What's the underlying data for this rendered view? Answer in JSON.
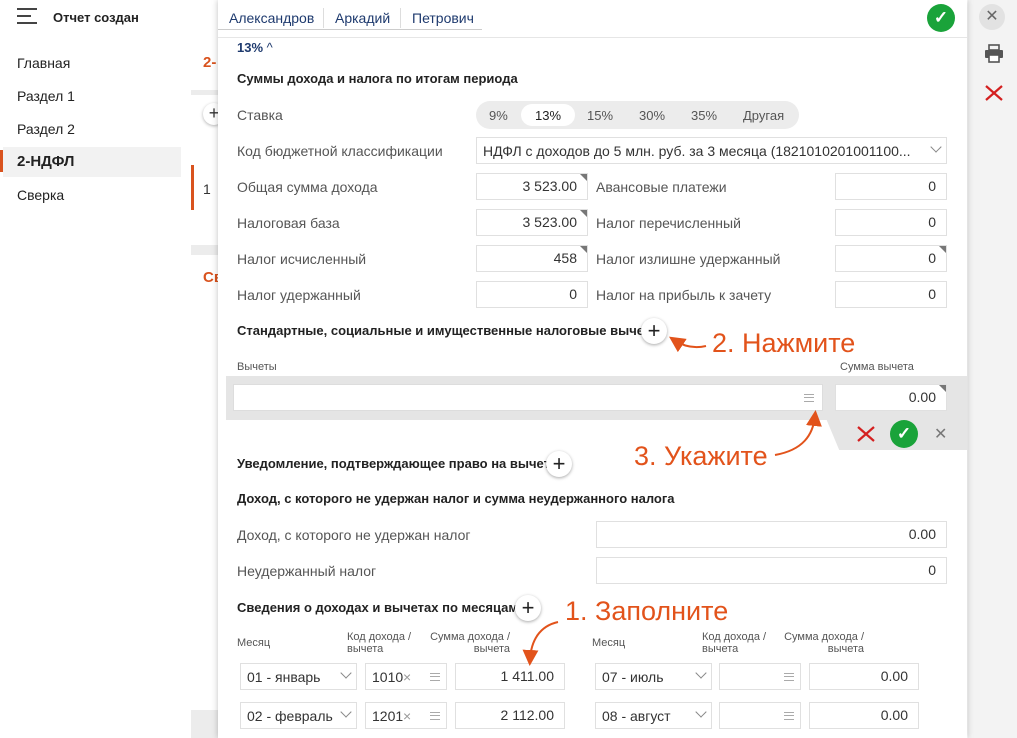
{
  "header": {
    "menu_title": "Отчет создан",
    "name_parts": [
      "Александров",
      "Аркадий",
      "Петрович"
    ],
    "rate_dropdown": "13%"
  },
  "sidebar": {
    "items": [
      "Главная",
      "Раздел 1",
      "Раздел 2",
      "2-НДФЛ",
      "Сверка"
    ]
  },
  "background": {
    "frag1": "2-",
    "frag2": "1",
    "frag3": "Св"
  },
  "section_totals": {
    "title": "Суммы дохода и налога по итогам периода",
    "rate_label": "Ставка",
    "rates": [
      "9%",
      "13%",
      "15%",
      "30%",
      "35%",
      "Другая"
    ],
    "selected_rate": "13%",
    "kbk_label": "Код бюджетной классификации",
    "kbk_value": "НДФЛ с доходов до 5 млн. руб. за 3 месяца (1821010201001100...",
    "income_label": "Общая сумма дохода",
    "income_value": "3 523.00",
    "base_label": "Налоговая база",
    "base_value": "3 523.00",
    "calc_label": "Налог исчисленный",
    "calc_value": "458",
    "withheld_label": "Налог удержанный",
    "withheld_value": "0",
    "advance_label": "Авансовые платежи",
    "advance_value": "0",
    "transferred_label": "Налог перечисленный",
    "transferred_value": "0",
    "excess_label": "Налог излишне удержанный",
    "excess_value": "0",
    "profit_label": "Налог на прибыль к зачету",
    "profit_value": "0"
  },
  "deductions": {
    "title": "Стандартные, социальные и имущественные налоговые вычеты",
    "col_deduction": "Вычеты",
    "col_sum": "Сумма вычета",
    "sum_value": "0.00"
  },
  "notice": {
    "title": "Уведомление, подтверждающее право на вычет"
  },
  "unwithheld": {
    "title": "Доход, с которого не удержан налог и сумма неудержанного налога",
    "income_label": "Доход, с которого не удержан налог",
    "income_value": "0.00",
    "tax_label": "Неудержанный налог",
    "tax_value": "0"
  },
  "monthly": {
    "title": "Сведения о доходах и вычетах по месяцам",
    "col_month": "Месяц",
    "col_code": "Код дохода /вычета",
    "col_sum": "Сумма дохода /вычета",
    "rows_left": [
      {
        "month": "01 - январь",
        "code": "1010",
        "sum": "1 411.00"
      },
      {
        "month": "02 - февраль",
        "code": "1201",
        "sum": "2 112.00"
      }
    ],
    "rows_right": [
      {
        "month": "07 - июль",
        "code": "",
        "sum": "0.00"
      },
      {
        "month": "08 - август",
        "code": "",
        "sum": "0.00"
      }
    ]
  },
  "annotations": {
    "step1": "1. Заполните",
    "step2": "2. Нажмите",
    "step3": "3. Укажите"
  },
  "colors": {
    "accent": "#d9531e",
    "confirm": "#1aa33a",
    "annotation": "#e2531b"
  }
}
